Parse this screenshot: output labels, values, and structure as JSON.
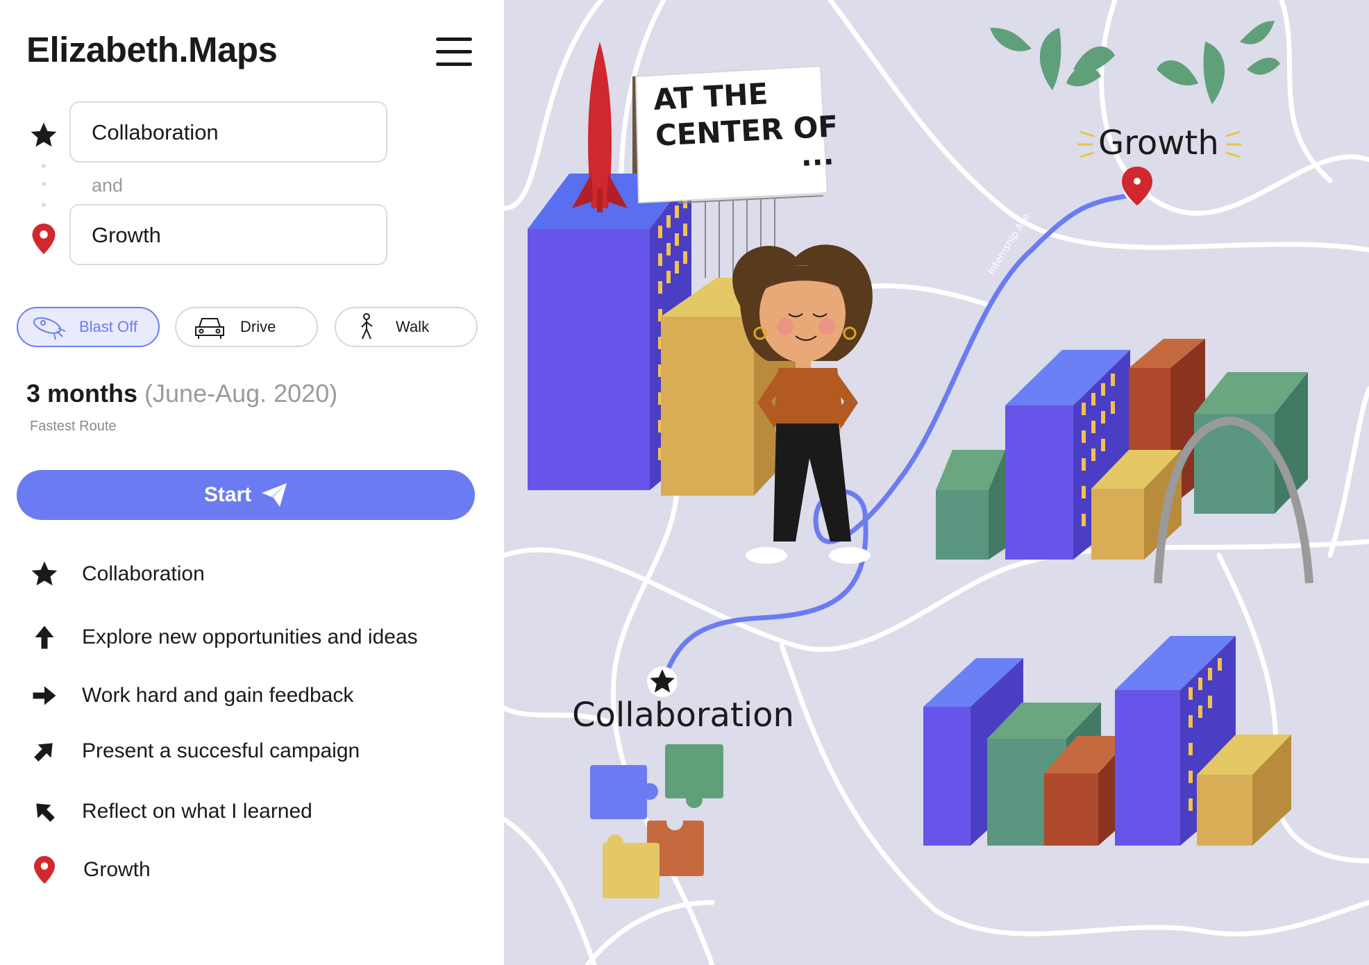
{
  "app": {
    "title": "Elizabeth.Maps"
  },
  "route": {
    "from": {
      "value": "Collaboration",
      "icon": "star-icon"
    },
    "connector": "and",
    "to": {
      "value": "Growth",
      "icon": "location-pin-icon"
    }
  },
  "modes": [
    {
      "label": "Blast Off",
      "icon": "rocket-icon",
      "selected": true
    },
    {
      "label": "Drive",
      "icon": "car-icon",
      "selected": false
    },
    {
      "label": "Walk",
      "icon": "walking-person-icon",
      "selected": false
    }
  ],
  "trip": {
    "duration": "3 months",
    "dates": "(June-Aug. 2020)",
    "route_type": "Fastest Route"
  },
  "start_label": "Start",
  "steps": [
    {
      "icon": "star-icon",
      "label": "Collaboration"
    },
    {
      "icon": "arrow-up-icon",
      "label": "Explore new opportunities and ideas"
    },
    {
      "icon": "arrow-right-icon",
      "label": "Work hard and gain feedback"
    },
    {
      "icon": "arrow-up-right-icon",
      "label": "Present a succesful campaign"
    },
    {
      "icon": "arrow-up-left-icon",
      "label": "Reflect on what I learned"
    },
    {
      "icon": "location-pin-icon",
      "label": "Growth"
    }
  ],
  "map": {
    "billboard_lines": [
      "AT THE",
      "CENTER OF",
      "..."
    ],
    "destination_label": "Growth",
    "origin_label": "Collaboration",
    "street_label": "Internship Ave."
  },
  "colors": {
    "accent": "#6b7cf2",
    "map_background": "#dcdcea",
    "pin_red": "#d0282e",
    "building_blue": "#6655e8",
    "building_yellow": "#d9ad55",
    "building_green": "#5a9680",
    "building_orange": "#c0552f"
  }
}
